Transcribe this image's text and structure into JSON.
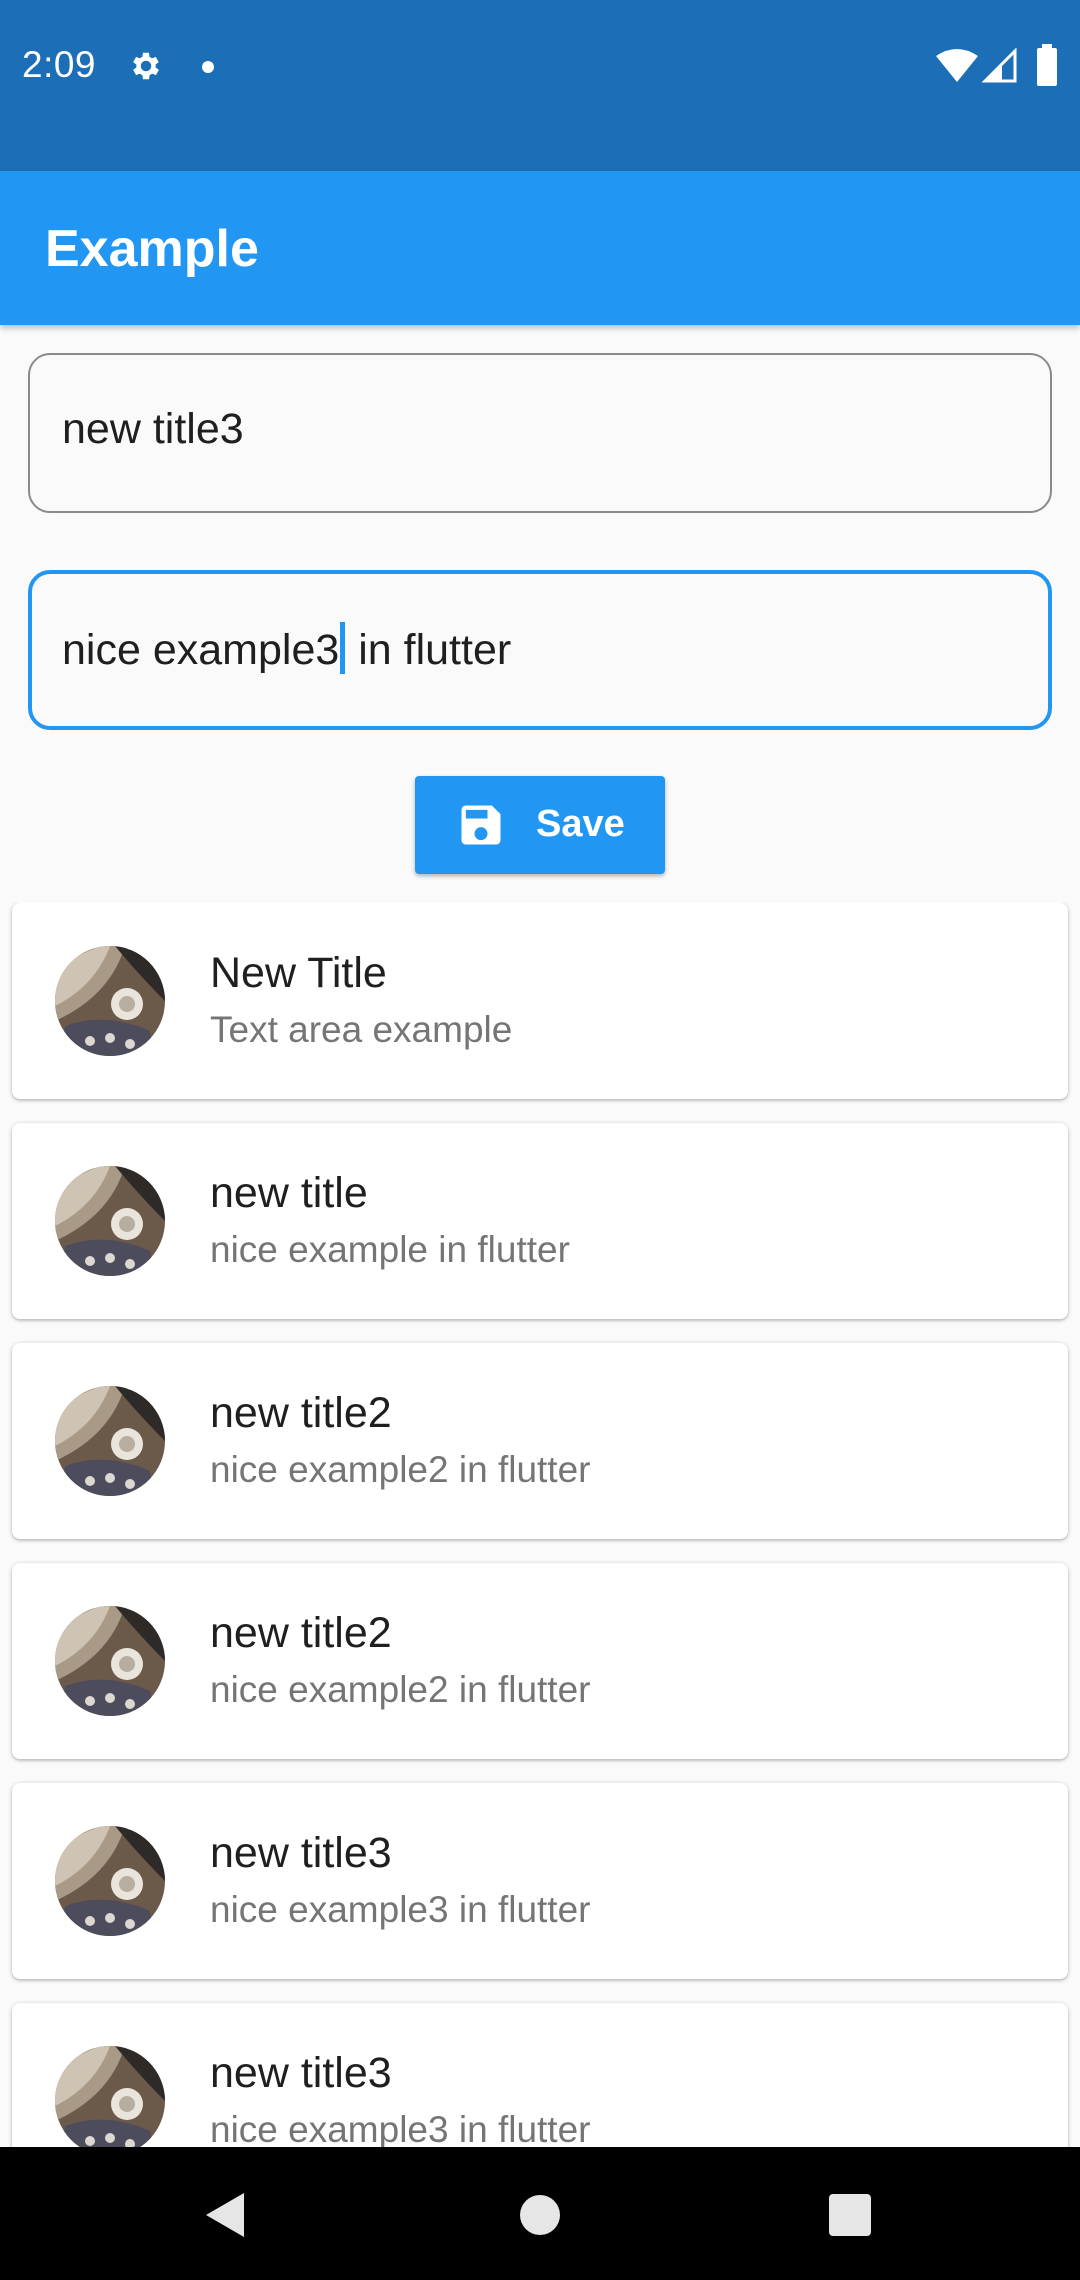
{
  "status_bar": {
    "time": "2:09",
    "icons": [
      "gear-icon",
      "notification-dot-icon",
      "wifi-icon",
      "cell-signal-icon",
      "battery-icon"
    ]
  },
  "app_bar": {
    "title": "Example",
    "color": "#2196f3"
  },
  "form": {
    "title_field": {
      "value": "new title3"
    },
    "description_field": {
      "value_before_cursor": "nice example3",
      "value_after_cursor": " in flutter"
    },
    "save_button": {
      "label": "Save",
      "icon": "floppy-disk-icon"
    }
  },
  "items": [
    {
      "title": "New Title",
      "subtitle": "Text area example"
    },
    {
      "title": "new title",
      "subtitle": "nice example in flutter"
    },
    {
      "title": "new title2",
      "subtitle": "nice example2 in flutter"
    },
    {
      "title": "new title2",
      "subtitle": "nice example2 in flutter"
    },
    {
      "title": "new title3",
      "subtitle": "nice example3 in flutter"
    },
    {
      "title": "new title3",
      "subtitle": "nice example3 in flutter"
    }
  ],
  "nav_bar": {
    "icons": [
      "back-icon",
      "home-icon",
      "recents-icon"
    ]
  },
  "colors": {
    "status_bar": "#1c6fb6",
    "accent": "#2196f3",
    "background": "#fafafa"
  }
}
